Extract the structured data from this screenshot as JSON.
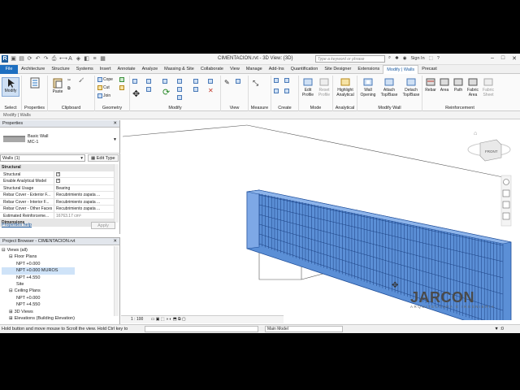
{
  "window": {
    "title": "CIMENTACION.rvt - 3D View: {3D}",
    "search_placeholder": "Type a keyword or phrase",
    "sign_in": "Sign In"
  },
  "tabs": [
    "File",
    "Architecture",
    "Structure",
    "Systems",
    "Insert",
    "Annotate",
    "Analyze",
    "Massing & Site",
    "Collaborate",
    "View",
    "Manage",
    "Add-Ins",
    "Quantification",
    "Site Designer",
    "Extensions",
    "Modify | Walls",
    "Precast"
  ],
  "ribbon": {
    "select": "Select",
    "properties": "Properties",
    "clipboard": "Clipboard",
    "paste": "Paste",
    "geometry": "Geometry",
    "cope": "Cope",
    "cut": "Cut",
    "join": "Join",
    "modify": "Modify",
    "view": "View",
    "measure": "Measure",
    "create": "Create",
    "edit_profile": "Edit Profile",
    "reset_profile": "Reset Profile",
    "mode": "Mode",
    "highlight": "Highlight Analytical",
    "analytical": "Analytical",
    "wall_opening": "Wall Opening",
    "attach": "Attach Top/Base",
    "detach": "Detach Top/Base",
    "modify_wall": "Modify Wall",
    "rebar": "Rebar",
    "area": "Area",
    "path": "Path",
    "fabric_area": "Fabric Area",
    "fabric_sheet": "Fabric Sheet",
    "reinforcement": "Reinforcement"
  },
  "option_bar": "Modify | Walls",
  "properties": {
    "header": "Properties",
    "type_family": "Basic Wall",
    "type_name": "MC-1",
    "instance_filter": "Walls (1)",
    "edit_type": "Edit Type",
    "rows": [
      {
        "cat": "Structural"
      },
      {
        "k": "Structural",
        "check": true
      },
      {
        "k": "Enable Analytical Model",
        "check": true
      },
      {
        "k": "Structural Usage",
        "v": "Bearing"
      },
      {
        "k": "Rebar Cover - Exterior F...",
        "v": "Recubrimiento zapata ..."
      },
      {
        "k": "Rebar Cover - Interior F...",
        "v": "Recubrimiento zapata ..."
      },
      {
        "k": "Rebar Cover - Other Faces",
        "v": "Recubrimiento zapata ..."
      },
      {
        "k": "Estimated Reinforceme...",
        "v": "16763.17 cm³",
        "dim": true
      },
      {
        "cat": "Dimensions"
      }
    ],
    "help": "Properties help",
    "apply": "Apply"
  },
  "browser": {
    "header": "Project Browser - CIMENTACION.rvt",
    "items": [
      {
        "label": "Views (all)",
        "indent": 0,
        "exp": "⊟"
      },
      {
        "label": "Floor Plans",
        "indent": 1,
        "exp": "⊟"
      },
      {
        "label": "NPT +0.000",
        "indent": 2
      },
      {
        "label": "NPT +0.000 MUROS",
        "indent": 2,
        "selected": true
      },
      {
        "label": "NPT +4.550",
        "indent": 2
      },
      {
        "label": "Site",
        "indent": 2
      },
      {
        "label": "Ceiling Plans",
        "indent": 1,
        "exp": "⊟"
      },
      {
        "label": "NPT +0.000",
        "indent": 2
      },
      {
        "label": "NPT +4.550",
        "indent": 2
      },
      {
        "label": "3D Views",
        "indent": 1,
        "exp": "⊞"
      },
      {
        "label": "Elevations (Building Elevation)",
        "indent": 1,
        "exp": "⊞"
      }
    ]
  },
  "viewcube": {
    "label": "FRONT"
  },
  "view_control": {
    "scale": "1 : 100"
  },
  "status": {
    "text": "Hold button and move mouse to Scroll the view. Hold Ctrl key to",
    "model": "Main Model",
    "right": ":0"
  },
  "watermark": {
    "name": "JARCON",
    "sub": "ARQUITECTURA E INGENIERIA"
  },
  "colors": {
    "accent": "#1e6fc0",
    "wall": "#5b8fd6"
  }
}
